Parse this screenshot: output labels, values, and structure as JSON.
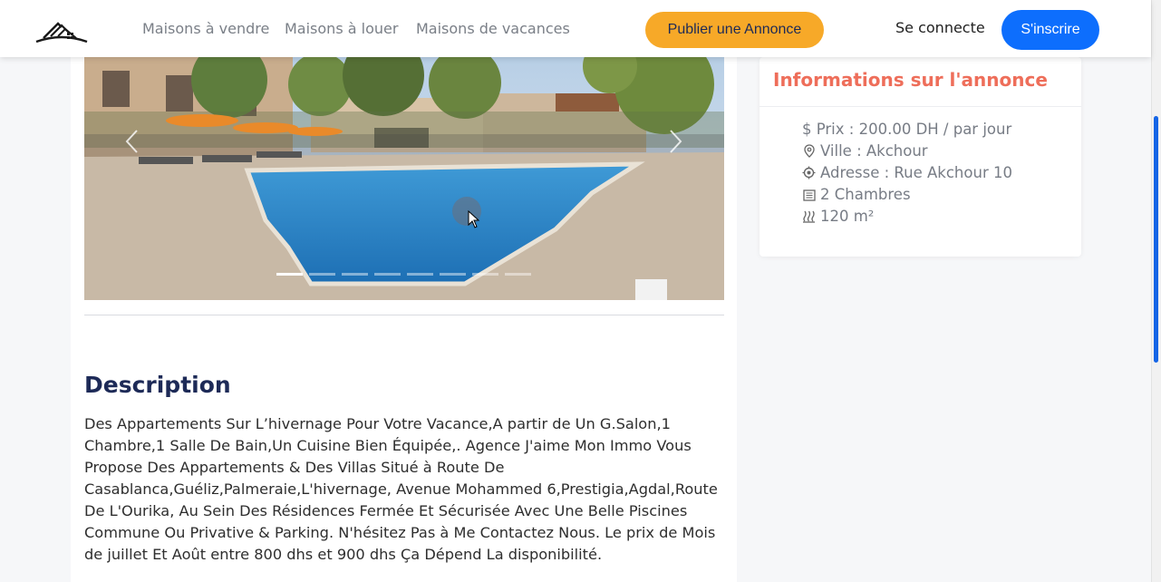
{
  "header": {
    "nav": [
      "Maisons à vendre",
      "Maisons à louer",
      "Maisons de vacances"
    ],
    "publish_label": "Publier une Annonce",
    "connect_label": "Se connecte",
    "signup_label": "S'inscrire"
  },
  "carousel": {
    "slide_count": 8,
    "active_index": 0,
    "image_alt": "Piscine de la résidence"
  },
  "description": {
    "title": "Description",
    "text": "Des Appartements Sur L’hivernage Pour Votre Vacance,A partir de Un G.Salon,1 Chambre,1 Salle De Bain,Un Cuisine Bien Équipée,. Agence J'aime Mon Immo Vous Propose Des Appartements & Des Villas Situé à Route De Casablanca,Guéliz,Palmeraie,L'hivernage, Avenue Mohammed 6,Prestigia,Agdal,Route De L'Ourika, Au Sein Des Résidences Fermée Et Sécurisée Avec Une Belle Piscines Commune Ou Privative & Parking. N'hésitez Pas à Me Contactez Nous. Le prix de Mois de juillet Et Août entre 800 dhs et 900 dhs Ça Dépend La disponibilité."
  },
  "info": {
    "title": "Informations sur l'annonce",
    "price": "$ Prix : 200.00 DH / par jour",
    "city": "Ville : Akchour",
    "address": "Adresse : Rue Akchour 10",
    "rooms": "2 Chambres",
    "area": "120 m²"
  },
  "colors": {
    "accent_orange": "#f7a928",
    "primary_blue": "#0d6efd",
    "title_navy": "#1d2a57",
    "info_title": "#ee6e5a"
  }
}
